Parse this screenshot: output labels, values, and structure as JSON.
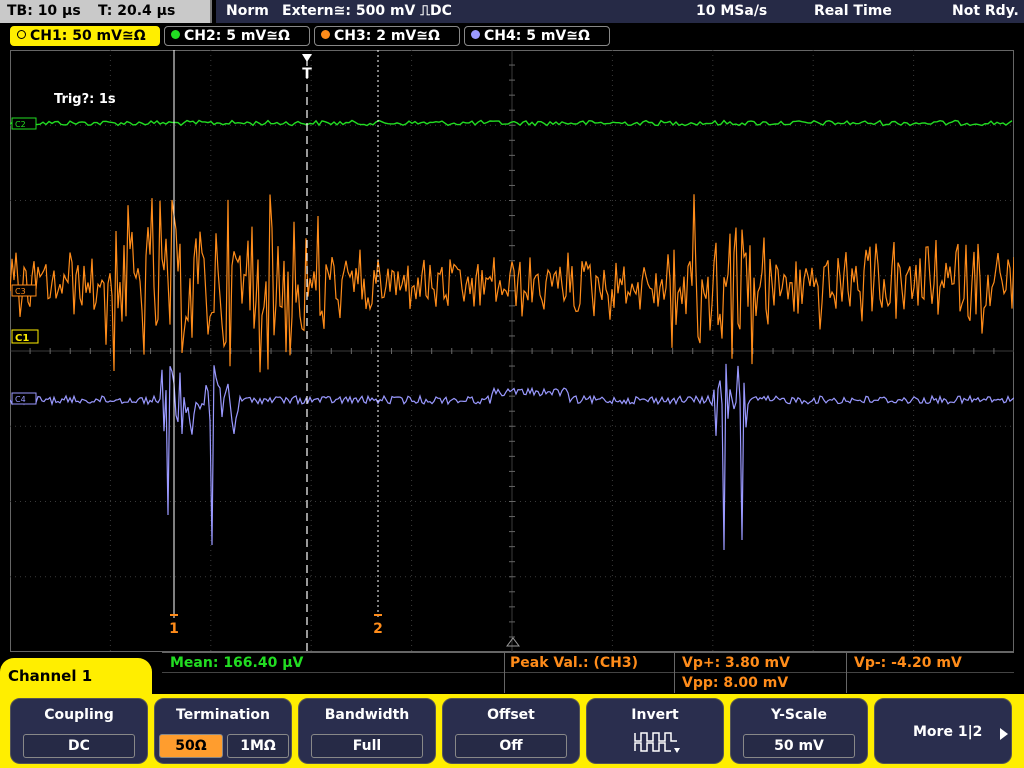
{
  "top": {
    "timebase": "TB: 10 µs",
    "trigger_time": "T: 20.4 µs",
    "mode": "Norm",
    "trigger_source": "Extern≅: 500 mV ⎍DC",
    "sample_rate": "10 MSa/s",
    "acquisition": "Real Time",
    "state": "Not Rdy."
  },
  "channels": [
    {
      "label": "CH1: 50 mV≅Ω",
      "color": "#ffee00",
      "active": true
    },
    {
      "label": "CH2: 5 mV≅Ω",
      "color": "#22dd22",
      "active": false
    },
    {
      "label": "CH3: 2 mV≅Ω",
      "color": "#ff8c1a",
      "active": false
    },
    {
      "label": "CH4: 5 mV≅Ω",
      "color": "#9a99ff",
      "active": false
    }
  ],
  "screen": {
    "trigger_status": "Trig?: 1s",
    "trigger_marker": "T",
    "cursor1_label": "1",
    "cursor2_label": "2",
    "ch1_marker": "C1",
    "ch2_marker": "C2",
    "ch3_marker": "C3",
    "ch4_marker": "C4"
  },
  "measurements": {
    "mean": "Mean: 166.40 µV",
    "peak_label": "Peak Val.:  (CH3)",
    "vp_plus": "Vp+: 3.80 mV",
    "vpp": "Vpp: 8.00 mV",
    "vp_minus": "Vp-: -4.20 mV"
  },
  "menu_title": "Channel 1",
  "softkeys": {
    "coupling": {
      "title": "Coupling",
      "value": "DC"
    },
    "termination": {
      "title": "Termination",
      "option_a": "50Ω",
      "option_b": "1MΩ"
    },
    "bandwidth": {
      "title": "Bandwidth",
      "value": "Full"
    },
    "offset": {
      "title": "Offset",
      "value": "Off"
    },
    "invert": {
      "title": "Invert"
    },
    "yscale": {
      "title": "Y-Scale",
      "value": "50 mV"
    },
    "more": {
      "title": "More 1|2"
    }
  },
  "colors": {
    "ch1": "#ffee00",
    "ch2": "#22dd22",
    "ch3": "#ff8c1a",
    "ch4": "#9a99ff",
    "status_bar": "#262a46",
    "softkey": "#2a2e4e"
  }
}
